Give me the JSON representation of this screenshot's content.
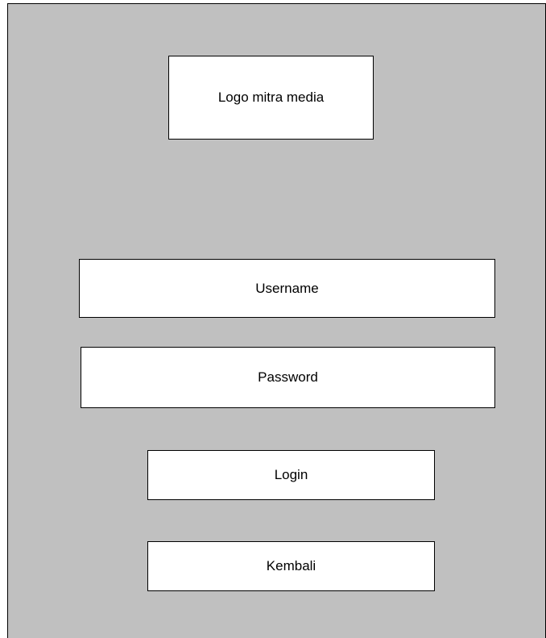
{
  "logo": {
    "label": "Logo mitra media"
  },
  "form": {
    "username_placeholder": "Username",
    "password_placeholder": "Password",
    "login_label": "Login",
    "back_label": "Kembali"
  },
  "colors": {
    "background": "#c0c0c0",
    "box": "#ffffff",
    "border": "#000000"
  }
}
